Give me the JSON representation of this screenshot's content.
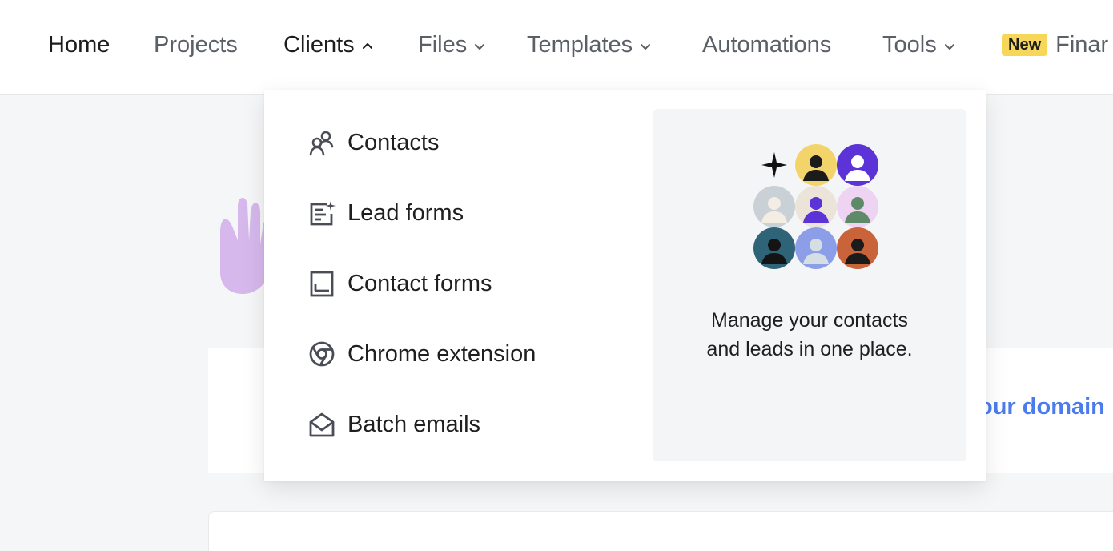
{
  "nav": {
    "items": [
      {
        "label": "Home"
      },
      {
        "label": "Projects"
      },
      {
        "label": "Clients"
      },
      {
        "label": "Files"
      },
      {
        "label": "Templates"
      },
      {
        "label": "Automations"
      },
      {
        "label": "Tools"
      },
      {
        "label": "Finar",
        "badge": "New"
      }
    ]
  },
  "dropdown": {
    "items": [
      {
        "label": "Contacts",
        "icon": "contacts-icon"
      },
      {
        "label": "Lead forms",
        "icon": "lead-form-icon"
      },
      {
        "label": "Contact forms",
        "icon": "contact-form-icon"
      },
      {
        "label": "Chrome extension",
        "icon": "chrome-icon"
      },
      {
        "label": "Batch emails",
        "icon": "batch-email-icon"
      }
    ],
    "promo": {
      "line1": "Manage your contacts",
      "line2": "and leads in one place."
    }
  },
  "background": {
    "domain_link": "our domain"
  },
  "colors": {
    "badge": "#f6d75a",
    "link": "#4b7bec",
    "hand": "#d6b8ec"
  }
}
